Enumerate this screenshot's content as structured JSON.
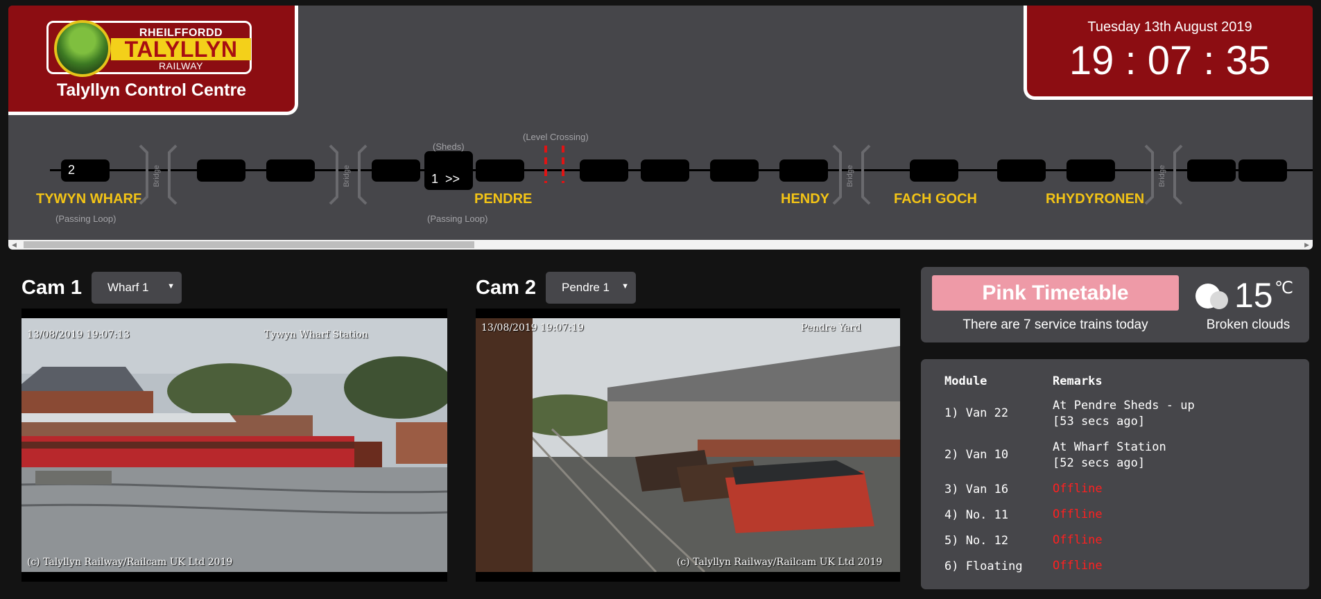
{
  "header": {
    "logo": {
      "top": "RHEILFFORDD",
      "main": "TALYLLYN",
      "bottom": "RAILWAY"
    },
    "title": "Talyllyn Control Centre",
    "date": "Tuesday 13th August 2019",
    "time": "19 : 07 : 35"
  },
  "track": {
    "sections": [
      {
        "label": "2"
      },
      {
        "label": ""
      },
      {
        "label": ""
      },
      {
        "label": ""
      },
      {
        "label": "1  >>"
      },
      {
        "label": ""
      },
      {
        "label": ""
      },
      {
        "label": ""
      },
      {
        "label": ""
      },
      {
        "label": ""
      },
      {
        "label": ""
      },
      {
        "label": ""
      },
      {
        "label": ""
      },
      {
        "label": ""
      },
      {
        "label": ""
      }
    ],
    "bridge_label": "Bridge",
    "stations": [
      "TYWYN WHARF",
      "PENDRE",
      "HENDY",
      "FACH GOCH",
      "RHYDYRONEN"
    ],
    "labels": {
      "passing_loop_1": "(Passing Loop)",
      "sheds": "(Sheds)",
      "passing_loop_2": "(Passing Loop)",
      "level_crossing": "(Level Crossing)"
    }
  },
  "cam1": {
    "label": "Cam 1",
    "select": "Wharf 1",
    "timestamp": "13/08/2019 19:07:13",
    "station": "Tywyn Wharf Station",
    "copyright": "(c) Talyllyn Railway/Railcam UK Ltd 2019"
  },
  "cam2": {
    "label": "Cam 2",
    "select": "Pendre 1",
    "timestamp": "13/08/2019 19:07:19",
    "station": "Pendre Yard",
    "copyright": "(c) Talyllyn Railway/Railcam UK Ltd 2019"
  },
  "timetable": {
    "name": "Pink Timetable",
    "color": "#ee9aa7",
    "subtitle": "There are 7 service trains today"
  },
  "weather": {
    "icon": "cloud-icon",
    "temp": "15",
    "unit": "℃",
    "desc": "Broken clouds"
  },
  "modules": {
    "headers": {
      "module": "Module",
      "remarks": "Remarks"
    },
    "rows": [
      {
        "name": "1) Van 22",
        "remark": "At Pendre Sheds - up",
        "remark2": "[53 secs ago]"
      },
      {
        "name": "2) Van 10",
        "remark": "At Wharf Station",
        "remark2": "[52 secs ago]"
      },
      {
        "name": "3) Van 16",
        "remark": "Offline",
        "remark2": ""
      },
      {
        "name": "4) No. 11",
        "remark": "Offline",
        "remark2": ""
      },
      {
        "name": "5) No. 12",
        "remark": "Offline",
        "remark2": ""
      },
      {
        "name": "6) Floating",
        "remark": "Offline",
        "remark2": ""
      }
    ]
  }
}
